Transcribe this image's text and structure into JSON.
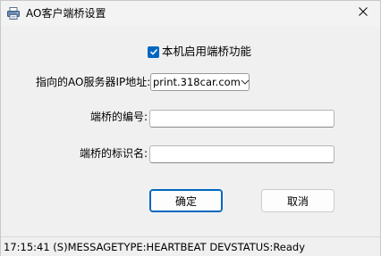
{
  "window": {
    "title": "AO客户端桥设置",
    "app_icon": "printer-icon",
    "close_icon": "close-icon"
  },
  "form": {
    "enable_label": "本机启用端桥功能",
    "enable_checked": true,
    "server_label": "指向的AO服务器IP地址:",
    "server_value": "print.318car.com",
    "bridge_id_label": "端桥的编号:",
    "bridge_id_value": "",
    "bridge_name_label": "端桥的标识名:",
    "bridge_name_value": ""
  },
  "buttons": {
    "ok_label": "确定",
    "cancel_label": "取消"
  },
  "status": {
    "text": "17:15:41 (S)MESSAGETYPE:HEARTBEAT   DEVSTATUS:Ready"
  },
  "colors": {
    "accent": "#0067c0"
  }
}
